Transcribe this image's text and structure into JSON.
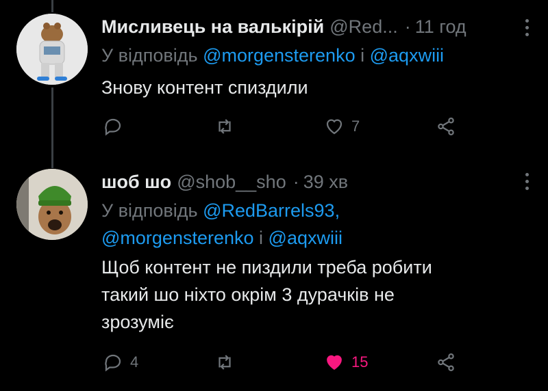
{
  "tweets": [
    {
      "display_name": "Мисливець на валькірій",
      "handle": "@Red...",
      "dot": "·",
      "time": "11 год",
      "reply_prefix": "У відповідь",
      "reply_mention_1": "@morgensterenko",
      "reply_and": "і",
      "reply_mention_2": "@aqxwiii",
      "text": "Знову контент спиздили",
      "reply_count": "",
      "retweet_count": "",
      "like_count": "7",
      "liked": false
    },
    {
      "display_name": "шоб шо",
      "handle": "@shob__sho",
      "dot": "·",
      "time": "39 хв",
      "reply_prefix": "У відповідь",
      "reply_mention_1": "@RedBarrels93,",
      "reply_mention_2": "@morgensterenko",
      "reply_and": "і",
      "reply_mention_3": "@aqxwiii",
      "text_line_1": "Щоб контент не пиздили треба робити",
      "text_line_2": "такий шо ніхто окрім 3 дурачків не",
      "text_line_3": "зрозуміє",
      "reply_count": "4",
      "retweet_count": "",
      "like_count": "15",
      "liked": true
    }
  ],
  "colors": {
    "background": "#000000",
    "text": "#e7e9ea",
    "muted": "#71767b",
    "link": "#1d9bf0",
    "like": "#f91880"
  },
  "icons": [
    "reply-icon",
    "retweet-icon",
    "like-icon",
    "share-icon",
    "more-icon"
  ]
}
